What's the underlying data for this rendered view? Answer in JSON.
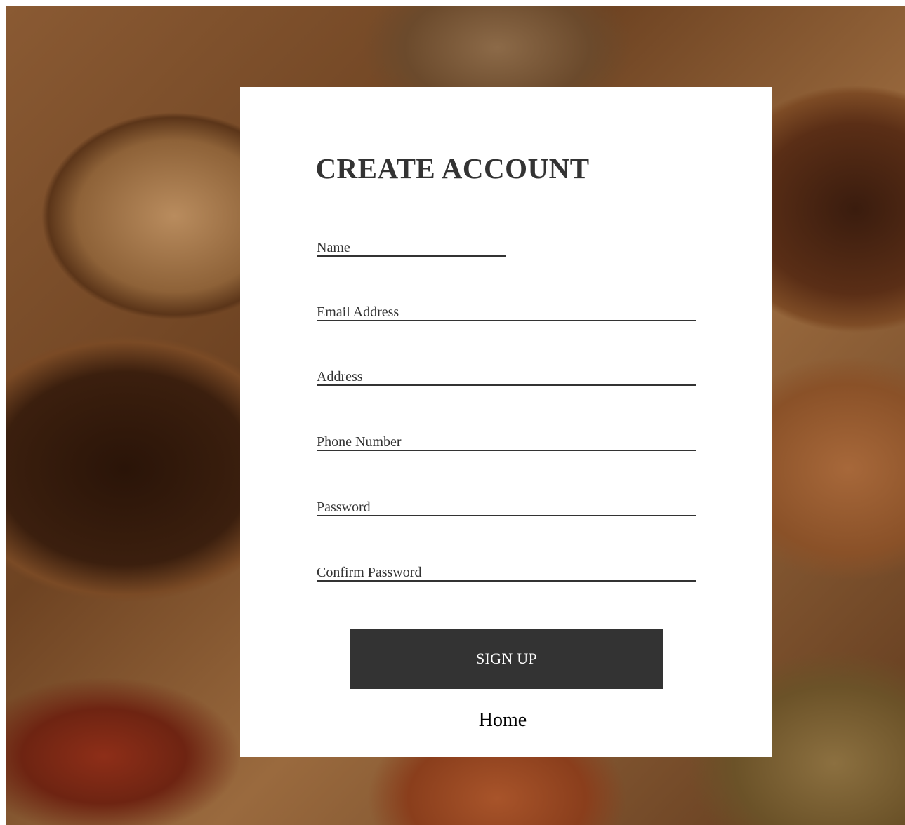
{
  "form": {
    "title": "CREATE ACCOUNT",
    "fields": [
      {
        "placeholder": "Name",
        "value": ""
      },
      {
        "placeholder": "Email Address",
        "value": ""
      },
      {
        "placeholder": "Address",
        "value": ""
      },
      {
        "placeholder": "Phone Number",
        "value": ""
      },
      {
        "placeholder": "Password",
        "value": ""
      },
      {
        "placeholder": "Confirm Password",
        "value": ""
      }
    ],
    "submit_label": "SIGN UP",
    "home_link": "Home"
  },
  "colors": {
    "card_background": "#ffffff",
    "text": "#333333",
    "button_background": "#333333",
    "button_text": "#ffffff"
  }
}
